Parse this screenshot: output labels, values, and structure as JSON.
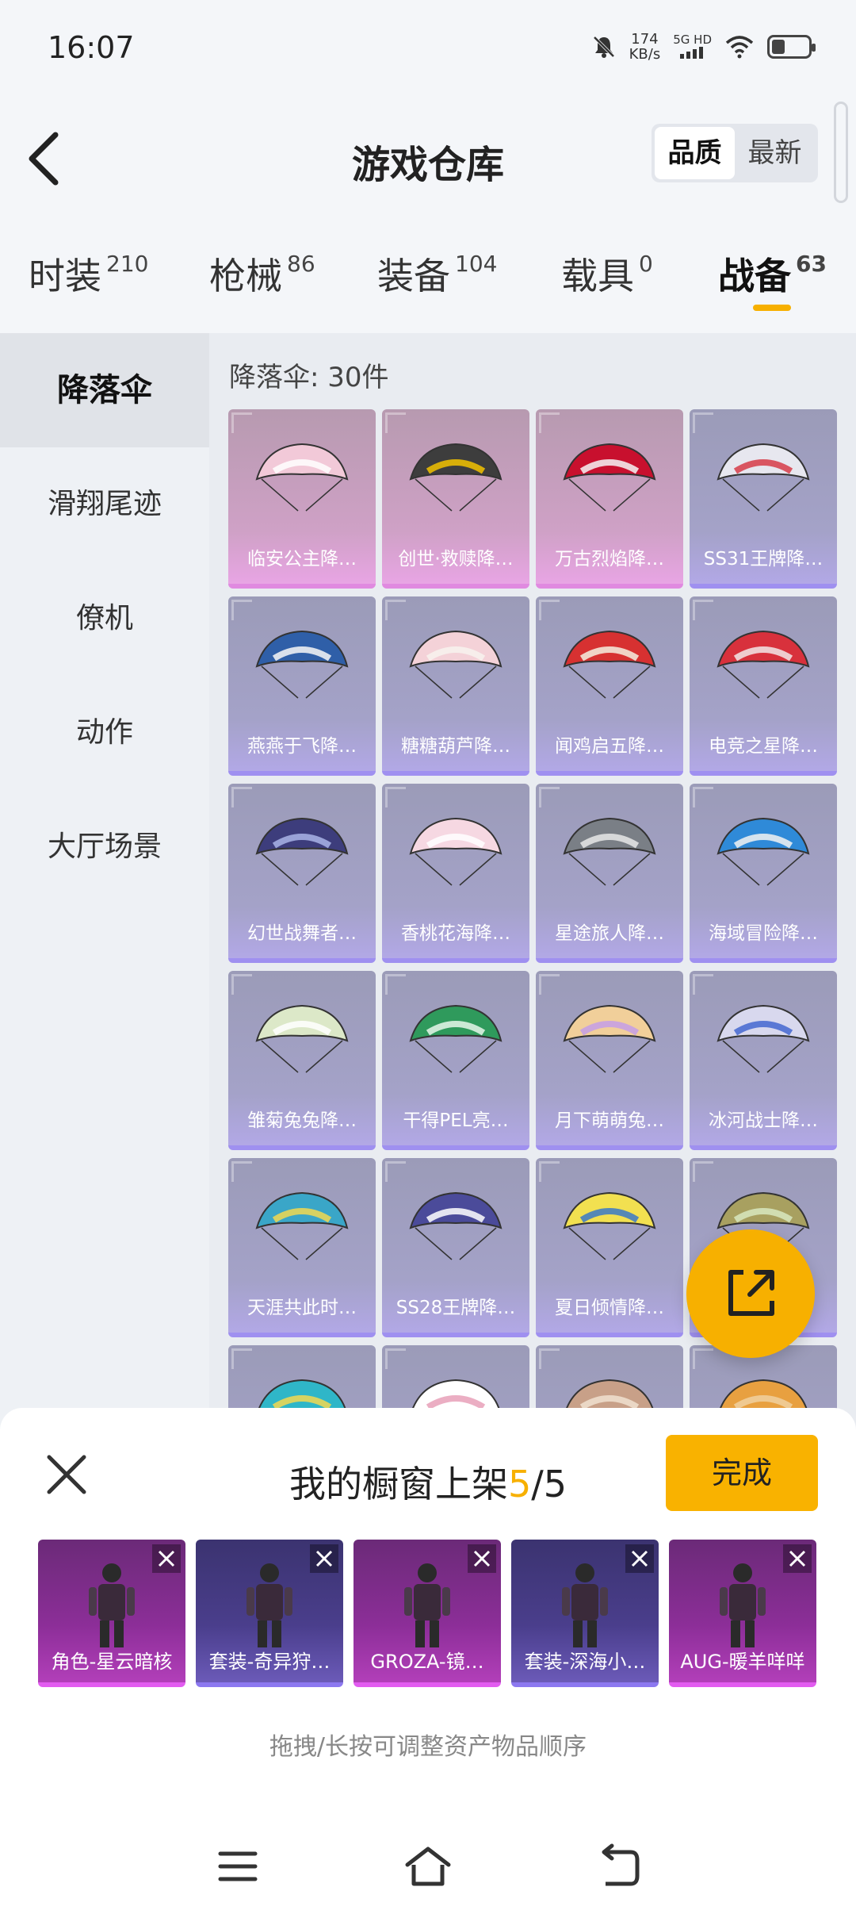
{
  "status_bar": {
    "time": "16:07",
    "speed_value": "174",
    "speed_unit": "KB/s",
    "network": "5G HD"
  },
  "header": {
    "title": "游戏仓库",
    "sort_options": [
      "品质",
      "最新"
    ],
    "sort_active": "品质"
  },
  "tabs": [
    {
      "label": "时装",
      "count": "210"
    },
    {
      "label": "枪械",
      "count": "86"
    },
    {
      "label": "装备",
      "count": "104"
    },
    {
      "label": "载具",
      "count": "0"
    },
    {
      "label": "战备",
      "count": "63"
    }
  ],
  "active_tab": "战备",
  "sidebar": {
    "items": [
      "降落伞",
      "滑翔尾迹",
      "僚机",
      "动作",
      "大厅场景"
    ],
    "active": "降落伞"
  },
  "section": {
    "title": "降落伞: 30件"
  },
  "items": [
    {
      "label": "临安公主降…",
      "tier": "pink"
    },
    {
      "label": "创世·救赎降…",
      "tier": "pink"
    },
    {
      "label": "万古烈焰降…",
      "tier": "pink"
    },
    {
      "label": "SS31王牌降…",
      "tier": "purple"
    },
    {
      "label": "燕燕于飞降…",
      "tier": "purple"
    },
    {
      "label": "糖糖葫芦降…",
      "tier": "purple"
    },
    {
      "label": "闻鸡启五降…",
      "tier": "purple"
    },
    {
      "label": "电竞之星降…",
      "tier": "purple"
    },
    {
      "label": "幻世战舞者…",
      "tier": "purple"
    },
    {
      "label": "香桃花海降…",
      "tier": "purple"
    },
    {
      "label": "星途旅人降…",
      "tier": "purple"
    },
    {
      "label": "海域冒险降…",
      "tier": "purple"
    },
    {
      "label": "雏菊兔兔降…",
      "tier": "purple"
    },
    {
      "label": "干得PEL亮…",
      "tier": "purple"
    },
    {
      "label": "月下萌萌兔…",
      "tier": "purple"
    },
    {
      "label": "冰河战士降…",
      "tier": "purple"
    },
    {
      "label": "天涯共此时…",
      "tier": "purple"
    },
    {
      "label": "SS28王牌降…",
      "tier": "purple"
    },
    {
      "label": "夏日倾情降…",
      "tier": "purple"
    },
    {
      "label": "",
      "tier": "purple"
    },
    {
      "label": "",
      "tier": "purple"
    },
    {
      "label": "",
      "tier": "purple"
    },
    {
      "label": "",
      "tier": "purple"
    },
    {
      "label": "",
      "tier": "purple"
    }
  ],
  "panel": {
    "title": "我的橱窗上架",
    "current": "5",
    "total": "/5",
    "done_label": "完成",
    "hint": "拖拽/长按可调整资产物品顺序",
    "shelf_items": [
      {
        "label": "角色-星云暗核",
        "tier": "pink"
      },
      {
        "label": "套装-奇异狩…",
        "tier": "blue"
      },
      {
        "label": "GROZA-镜…",
        "tier": "pink"
      },
      {
        "label": "套装-深海小…",
        "tier": "blue"
      },
      {
        "label": "AUG-暖羊咩咩",
        "tier": "pink"
      }
    ]
  },
  "icons": {
    "back": "back-arrow-icon",
    "share": "share-export-icon",
    "close": "close-icon",
    "menu": "menu-icon",
    "home": "home-icon",
    "return": "back-nav-icon"
  }
}
